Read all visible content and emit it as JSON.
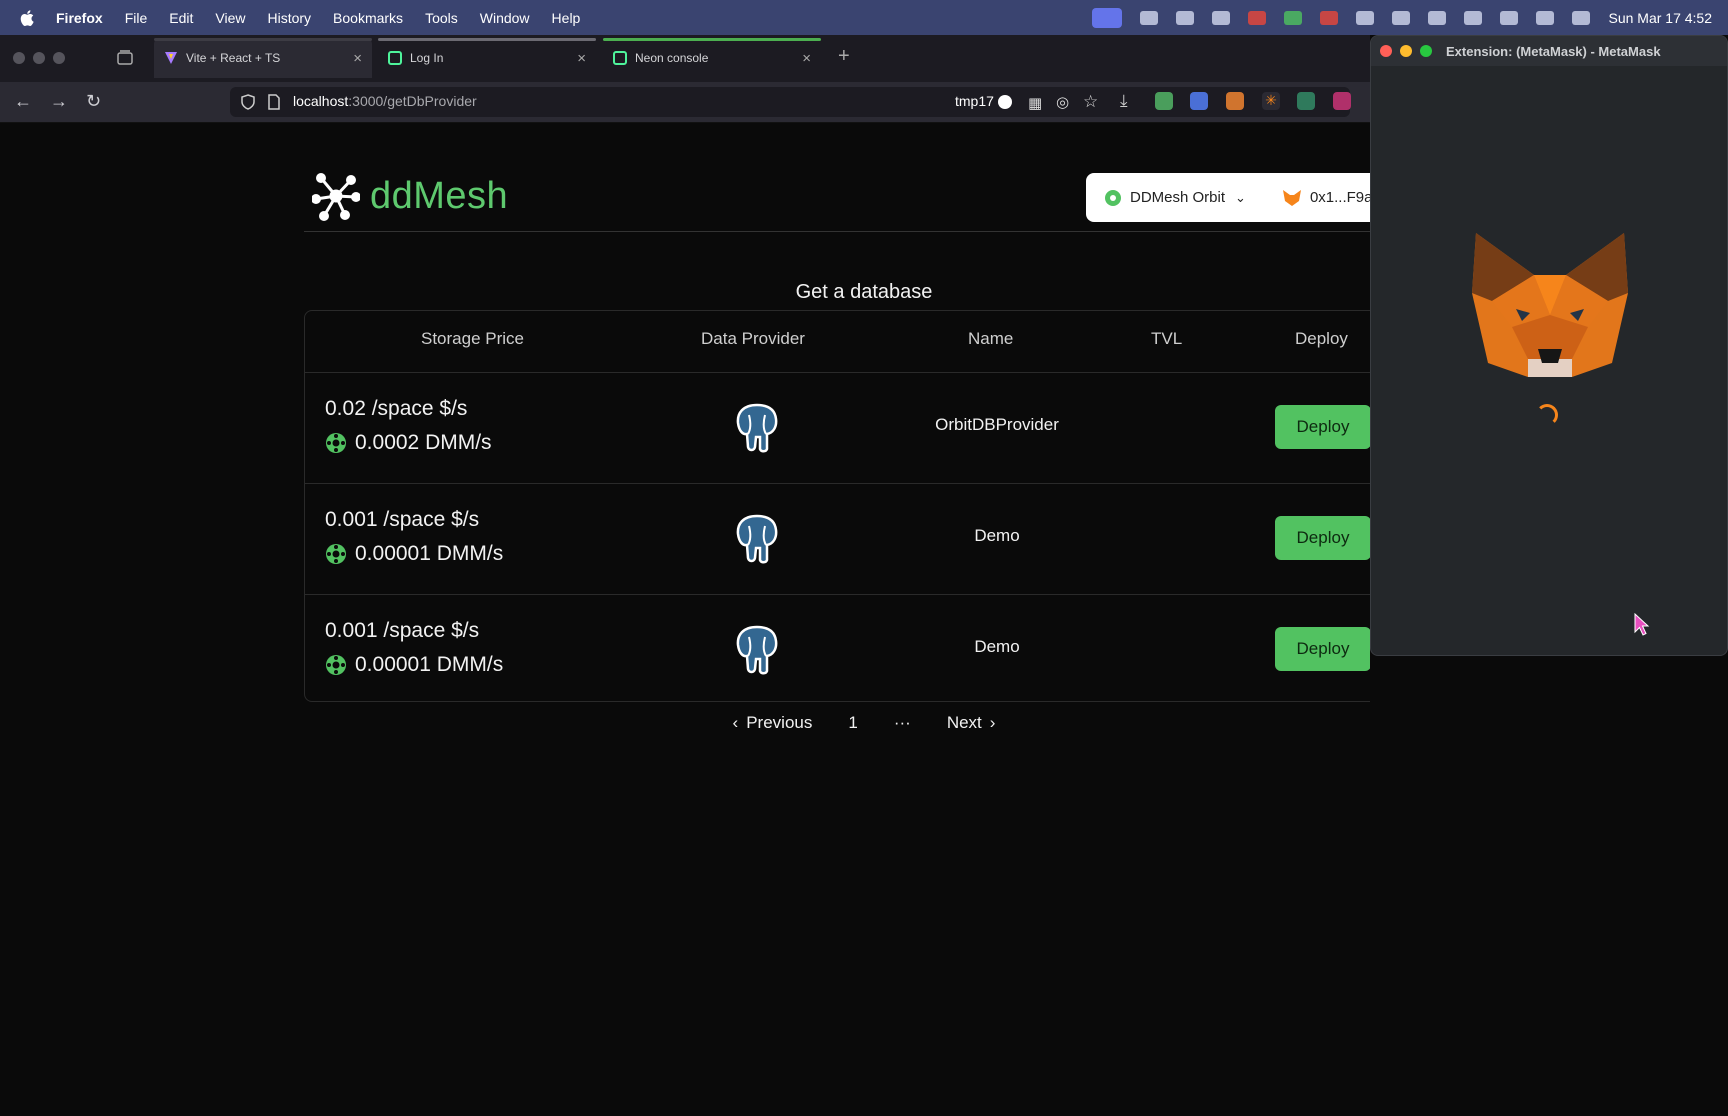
{
  "menubar": {
    "app": "Firefox",
    "items": [
      "File",
      "Edit",
      "View",
      "History",
      "Bookmarks",
      "Tools",
      "Window",
      "Help"
    ],
    "clock": "Sun Mar 17  4:52"
  },
  "browser": {
    "tabs": [
      {
        "title": "Vite + React + TS"
      },
      {
        "title": "Log In"
      },
      {
        "title": "Neon console"
      }
    ],
    "url_host": "localhost",
    "url_path": ":3000/getDbProvider",
    "profile": "tmp17"
  },
  "app": {
    "brand": "ddMesh",
    "network": "DDMesh Orbit",
    "address": "0x1...F9a",
    "heading": "Get a database",
    "columns": [
      "Storage Price",
      "Data Provider",
      "Name",
      "TVL",
      "Deploy"
    ],
    "rows": [
      {
        "price": "0.02 /space $/s",
        "token": "0.0002 DMM/s",
        "name": "OrbitDBProvider",
        "tvl": "",
        "deploy": "Deploy"
      },
      {
        "price": "0.001 /space $/s",
        "token": "0.00001 DMM/s",
        "name": "Demo",
        "tvl": "",
        "deploy": "Deploy"
      },
      {
        "price": "0.001 /space $/s",
        "token": "0.00001 DMM/s",
        "name": "Demo",
        "tvl": "",
        "deploy": "Deploy"
      }
    ],
    "pager": {
      "previous": "Previous",
      "page": "1",
      "ellipsis": "···",
      "next": "Next"
    }
  },
  "metamask": {
    "title": "Extension: (MetaMask) - MetaMask"
  },
  "colors": {
    "accent_green": "#52c261",
    "menubar": "#3a4470",
    "metamask_orange": "#f6851b"
  }
}
